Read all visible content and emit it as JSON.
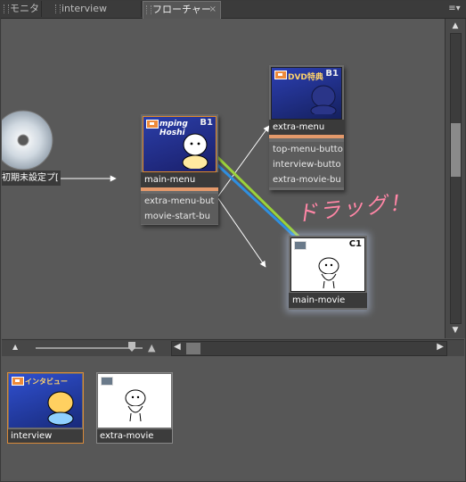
{
  "tabs": [
    {
      "label": "モニタ",
      "active": false
    },
    {
      "label": "interview",
      "active": false
    },
    {
      "label": "フローチャート",
      "active": true
    }
  ],
  "tab_close": "×",
  "panel_menu_icon": "≡▾",
  "disc_node": {
    "label": "初期未設定プ["
  },
  "nodes": {
    "main_menu": {
      "title": "main-menu",
      "badge": "B1",
      "buttons": [
        "extra-menu-but",
        "movie-start-bu"
      ],
      "thumb_text": "mping Hoshi"
    },
    "extra_menu": {
      "title": "extra-menu",
      "badge": "B1",
      "buttons": [
        "top-menu-butto",
        "interview-butto",
        "extra-movie-bu"
      ],
      "thumb_text": "DVD特典"
    },
    "main_movie": {
      "title": "main-movie",
      "badge": "C1"
    }
  },
  "drag_annotation": "ドラッグ！",
  "library": [
    {
      "title": "interview",
      "thumb_text": "インタビュー"
    },
    {
      "title": "extra-movie"
    }
  ],
  "colors": {
    "menu_accent": "#e3996b",
    "drag_text": "#ff86a6",
    "drag_line_green": "#9bd33a",
    "drag_line_blue": "#2f8fe0"
  }
}
